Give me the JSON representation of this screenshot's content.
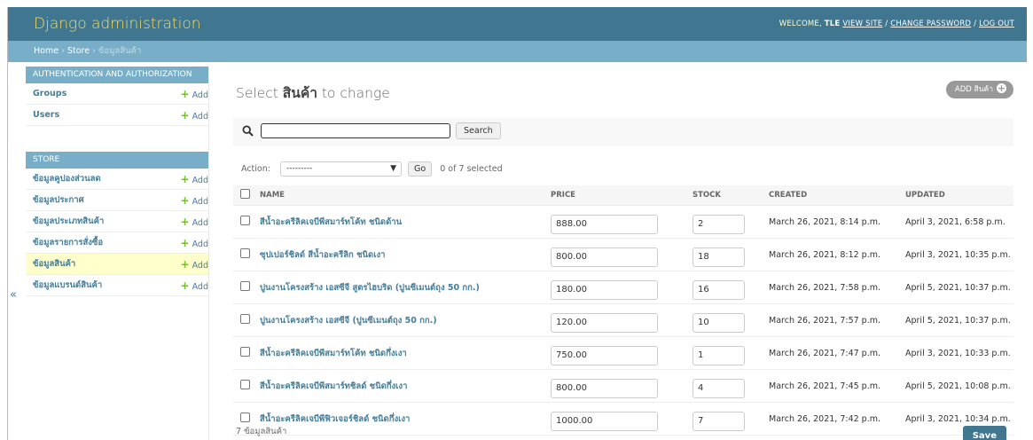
{
  "header": {
    "brand": "Django administration",
    "welcome": "WELCOME,",
    "user": "TLE",
    "view_site": "VIEW SITE",
    "change_password": "CHANGE PASSWORD",
    "logout": "LOG OUT",
    "sep": "/"
  },
  "breadcrumbs": {
    "home": "Home",
    "app": "Store",
    "current": "ข้อมูลสินค้า",
    "sep": "›"
  },
  "sidebar": {
    "toggle": "«",
    "modules": [
      {
        "caption": "AUTHENTICATION AND AUTHORIZATION",
        "items": [
          {
            "label": "Groups",
            "add": "Add"
          },
          {
            "label": "Users",
            "add": "Add"
          }
        ]
      },
      {
        "caption": "STORE",
        "items": [
          {
            "label": "ข้อมูลคูปองส่วนลด",
            "add": "Add"
          },
          {
            "label": "ข้อมูลประกาศ",
            "add": "Add"
          },
          {
            "label": "ข้อมูลประเภทสินค้า",
            "add": "Add"
          },
          {
            "label": "ข้อมูลรายการสั่งซื้อ",
            "add": "Add"
          },
          {
            "label": "ข้อมูลสินค้า",
            "add": "Add"
          },
          {
            "label": "ข้อมูลแบรนด์สินค้า",
            "add": "Add"
          }
        ]
      }
    ]
  },
  "main": {
    "title_prefix": "Select",
    "title_model": "สินค้า",
    "title_suffix": "to change",
    "add_button": "ADD สินค้า",
    "search": {
      "value": "",
      "button": "Search"
    },
    "actions": {
      "label": "Action:",
      "selected": "---------",
      "go": "Go",
      "counter": "0 of 7 selected"
    },
    "columns": [
      "NAME",
      "PRICE",
      "STOCK",
      "CREATED",
      "UPDATED"
    ],
    "rows": [
      {
        "name": "สีน้ำอะครีลิคเจบีพีสมาร์ทโค้ท ชนิดด้าน",
        "price": "888.00",
        "stock": "2",
        "created": "March 26, 2021, 8:14 p.m.",
        "updated": "April 3, 2021, 6:58 p.m."
      },
      {
        "name": "ซุปเปอร์ชิลด์ สีน้ำอะครีลิก ชนิดเงา",
        "price": "800.00",
        "stock": "18",
        "created": "March 26, 2021, 8:12 p.m.",
        "updated": "April 3, 2021, 10:35 p.m."
      },
      {
        "name": "ปูนงานโครงสร้าง เอสซีจี สูตรไฮบริด (ปูนซีเมนต์ถุง 50 กก.)",
        "price": "180.00",
        "stock": "16",
        "created": "March 26, 2021, 7:58 p.m.",
        "updated": "April 5, 2021, 10:37 p.m."
      },
      {
        "name": "ปูนงานโครงสร้าง เอสซีจี (ปูนซีเมนต์ถุง 50 กก.)",
        "price": "120.00",
        "stock": "10",
        "created": "March 26, 2021, 7:57 p.m.",
        "updated": "April 5, 2021, 10:37 p.m."
      },
      {
        "name": "สีน้ำอะครีลิคเจบีพีสมาร์ทโค้ท ชนิดกึ่งเงา",
        "price": "750.00",
        "stock": "1",
        "created": "March 26, 2021, 7:47 p.m.",
        "updated": "April 3, 2021, 10:33 p.m."
      },
      {
        "name": "สีน้ำอะครีลิคเจบีพีสมาร์ทชิลด์ ชนิดกึ่งเงา",
        "price": "800.00",
        "stock": "4",
        "created": "March 26, 2021, 7:45 p.m.",
        "updated": "April 5, 2021, 10:08 p.m."
      },
      {
        "name": "สีน้ำอะครีลิคเจบีพีฟิวเจอร์ชิลด์ ชนิดกึ่งเงา",
        "price": "1000.00",
        "stock": "7",
        "created": "March 26, 2021, 7:42 p.m.",
        "updated": "April 3, 2021, 10:34 p.m."
      }
    ],
    "footer_count": "7 ข้อมูลสินค้า",
    "save": "Save"
  },
  "icons": {
    "search": "search-icon",
    "add": "plus-icon",
    "collapse": "chevron-double-left-icon",
    "dropdown": "chevron-down-icon"
  },
  "colors": {
    "header": "#417690",
    "breadcrumbs": "#79aec8",
    "brand": "#f5dd5d",
    "link": "#447e9b",
    "add_green": "#70bf2b",
    "selected_row": "#ffffcc"
  }
}
